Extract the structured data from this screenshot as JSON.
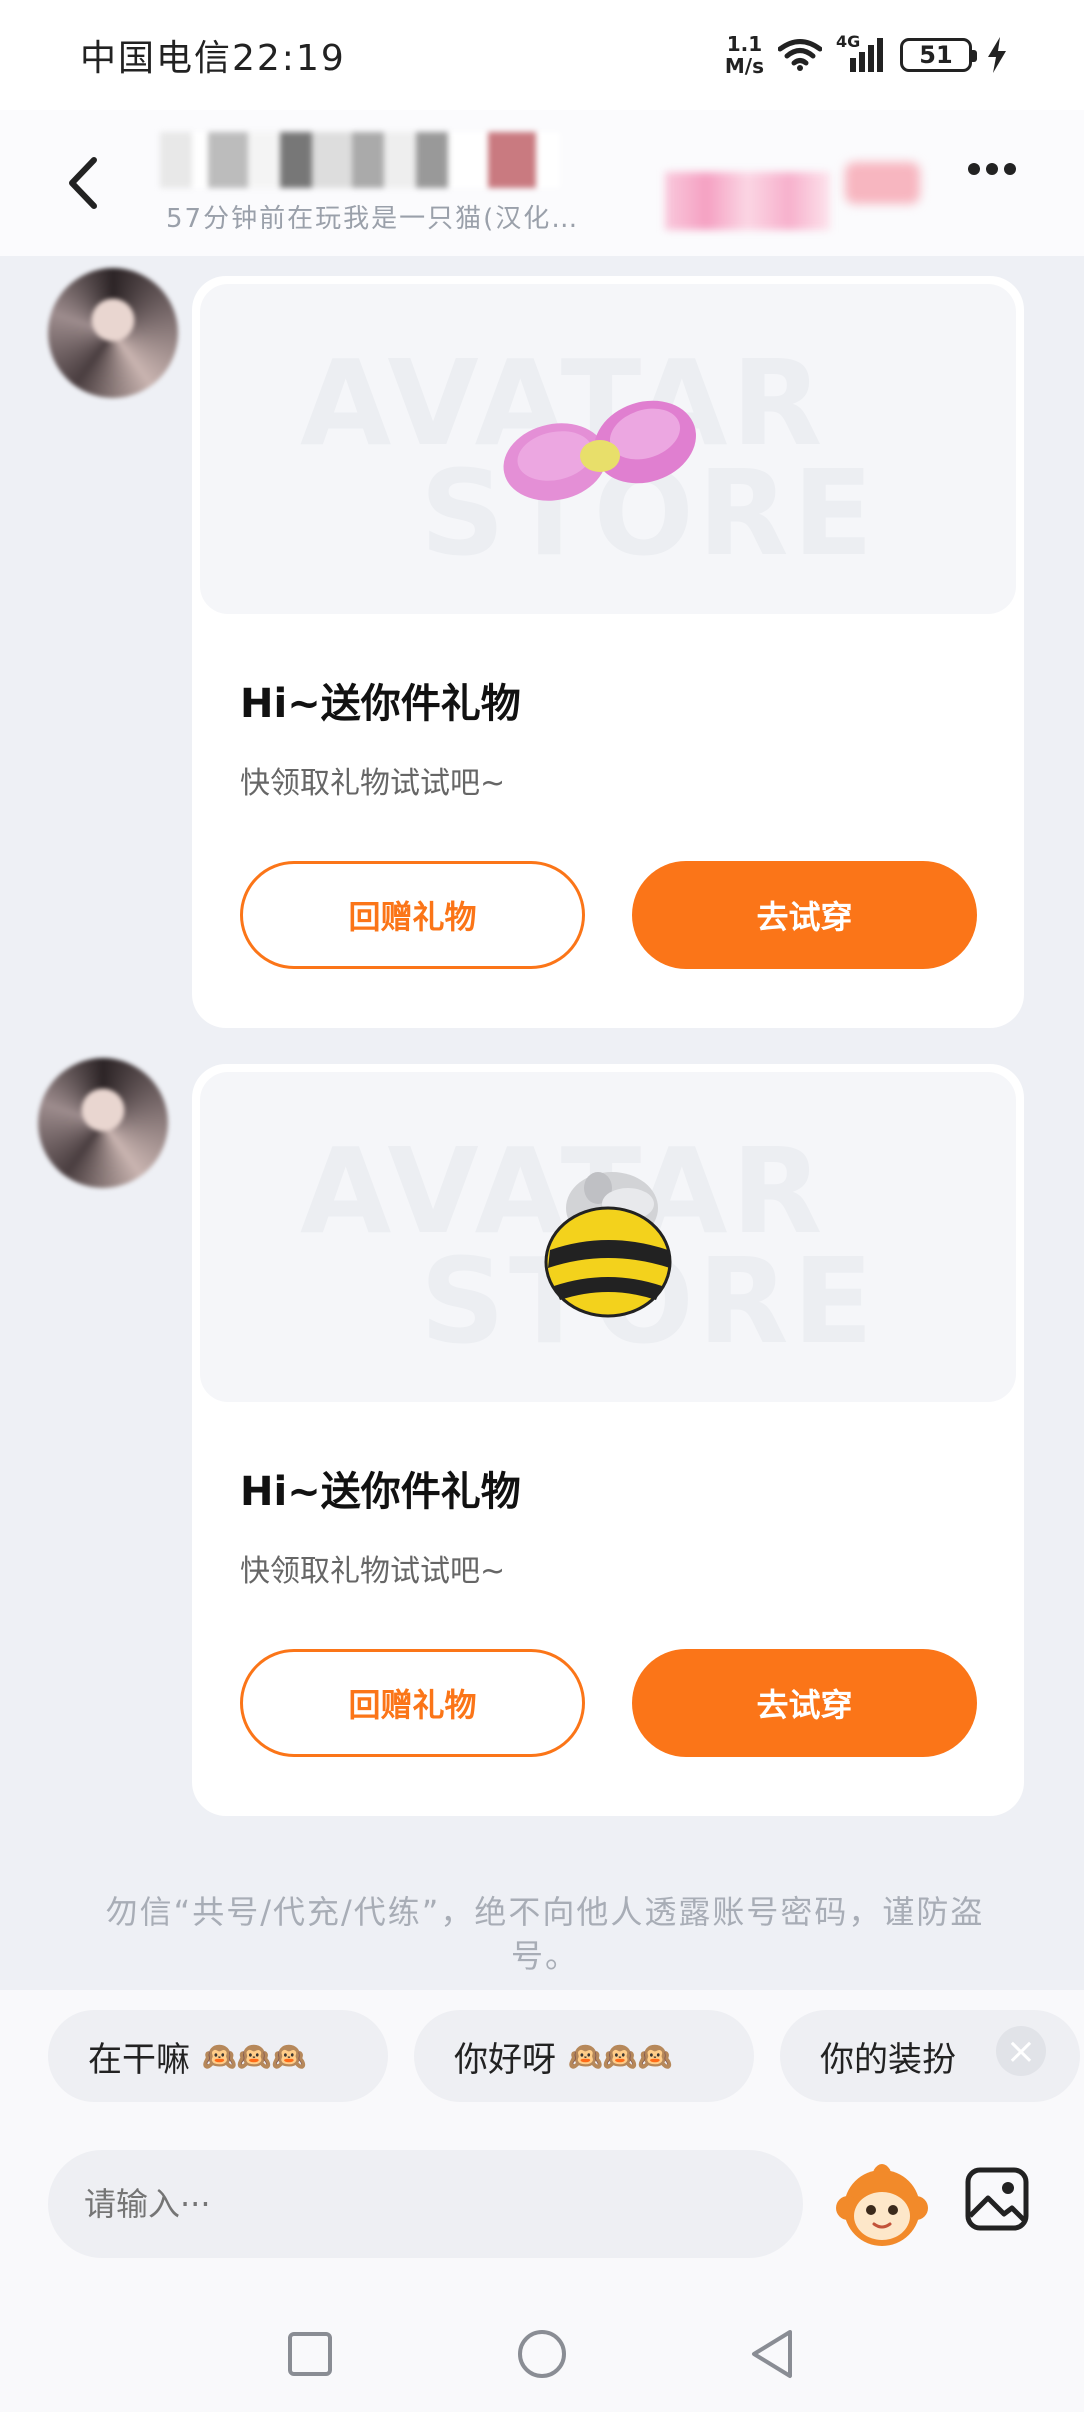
{
  "status_bar": {
    "carrier_time": "中国电信22:19",
    "net_speed_value": "1.1",
    "net_speed_unit": "M/s",
    "network_type": "4G",
    "battery": "51"
  },
  "header": {
    "name": "",
    "subtitle": "57分钟前在玩我是一只猫(汉化…"
  },
  "messages": [
    {
      "title": "Hi~送你件礼物",
      "description": "快领取礼物试试吧~",
      "watermark_line1": "AVATAR",
      "watermark_line2": "STORE",
      "return_gift_label": "回赠礼物",
      "try_on_label": "去试穿",
      "gift_icon": "pink-bow-icon"
    },
    {
      "title": "Hi~送你件礼物",
      "description": "快领取礼物试试吧~",
      "watermark_line1": "AVATAR",
      "watermark_line2": "STORE",
      "return_gift_label": "回赠礼物",
      "try_on_label": "去试穿",
      "gift_icon": "bee-costume-icon"
    }
  ],
  "notice": "勿信“共号/代充/代练”，绝不向他人透露账号密码，谨防盗号。",
  "quick_replies": [
    {
      "text": "在干嘛",
      "emoji": "🙉🙉🙉"
    },
    {
      "text": "你好呀",
      "emoji": "🙉🙉🙉"
    },
    {
      "text": "你的装扮",
      "emoji": ""
    }
  ],
  "input": {
    "placeholder": "请输入···"
  },
  "colors": {
    "accent": "#fb7518",
    "background": "#eef0f5",
    "card": "#ffffff"
  }
}
